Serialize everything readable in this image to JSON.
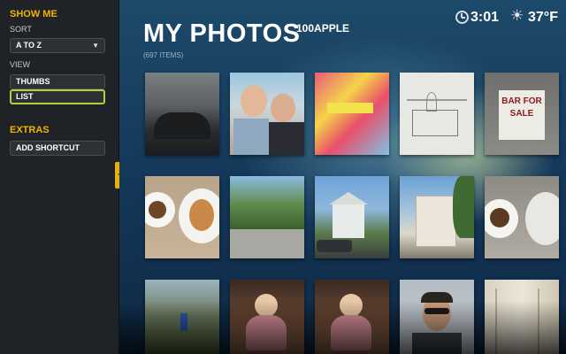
{
  "sidebar": {
    "show_me": "SHOW ME",
    "sort_label": "SORT",
    "sort_value": "A TO Z",
    "view_label": "VIEW",
    "view_options": [
      "THUMBS",
      "LIST"
    ],
    "extras": "EXTRAS",
    "add_shortcut": "ADD SHORTCUT"
  },
  "header": {
    "title": "MY PHOTOS",
    "album": "100APPLE",
    "count": "(697 ITEMS)",
    "time": "3:01",
    "temperature": "37°F"
  },
  "photos": [
    {
      "name": "photo-car-interior"
    },
    {
      "name": "photo-couple-selfie"
    },
    {
      "name": "photo-magazines"
    },
    {
      "name": "photo-sketch-drawing"
    },
    {
      "name": "photo-bar-for-sale-sign",
      "text": "BAR FOR SALE"
    },
    {
      "name": "photo-coffee-pastry"
    },
    {
      "name": "photo-street-trees"
    },
    {
      "name": "photo-house"
    },
    {
      "name": "photo-apartment-building"
    },
    {
      "name": "photo-coffee-cup"
    },
    {
      "name": "photo-forest-person"
    },
    {
      "name": "photo-doll-1"
    },
    {
      "name": "photo-doll-2"
    },
    {
      "name": "photo-man-sunglasses"
    },
    {
      "name": "photo-room-curtain"
    }
  ],
  "colors": {
    "accent": "#f0b400",
    "selected": "#aad43a",
    "sidebar_bg": "#1f2226"
  }
}
